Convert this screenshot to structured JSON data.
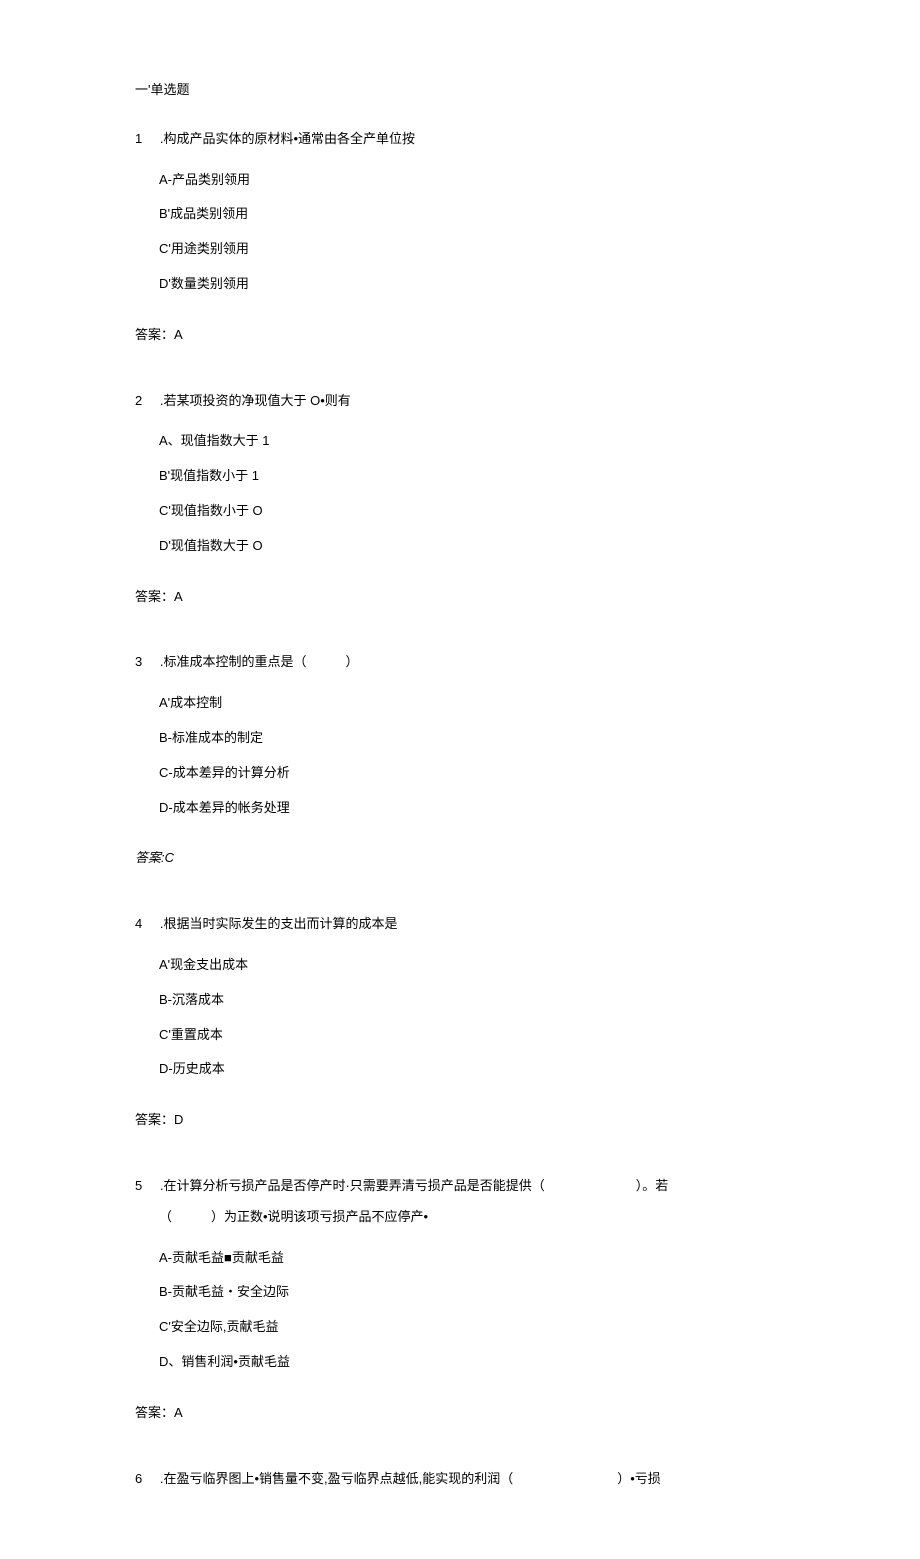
{
  "section_header": "一'单选题",
  "questions": [
    {
      "number": "1",
      "text": ".构成产品实体的原材料•通常由各全产单位按",
      "options": [
        "A-产品类别领用",
        "B'成品类别领用",
        "C'用途类别领用",
        "D'数量类别领用"
      ],
      "answer": "答案：A"
    },
    {
      "number": "2",
      "text": ".若某项投资的净现值大于 O•则有",
      "options": [
        "A、现值指数大于 1",
        "B'现值指数小于 1",
        "C'现值指数小于 O",
        "D'现值指数大于 O"
      ],
      "answer": "答案：A"
    },
    {
      "number": "3",
      "text": ".标准成本控制的重点是（　　　）",
      "options": [
        "A'成本控制",
        "B-标准成本的制定",
        "C-成本差异的计算分析",
        "D-成本差异的帐务处理"
      ],
      "answer": "答案:C",
      "answer_italic": true
    },
    {
      "number": "4",
      "text": ".根据当时实际发生的支出而计算的成本是",
      "options": [
        "A'现金支出成本",
        "B-沉落成本",
        "C'重置成本",
        "D-历史成本"
      ],
      "answer": "答案：D"
    },
    {
      "number": "5",
      "text": ".在计算分析亏损产品是否停产时·只需要弄清亏损产品是否能提供（　　　　　　　）。若",
      "text_line2": "（　　　）为正数•说明该项亏损产品不应停产•",
      "options": [
        "A-贡献毛益■贡献毛益",
        "B-贡献毛益・安全边际",
        "C'安全边际,贡献毛益",
        "D、销售利润•贡献毛益"
      ],
      "answer": "答案：A"
    },
    {
      "number": "6",
      "text": ".在盈亏临界图上•销售量不变,盈亏临界点越低,能实现的利润（　　　　　　　　）•亏损"
    }
  ]
}
